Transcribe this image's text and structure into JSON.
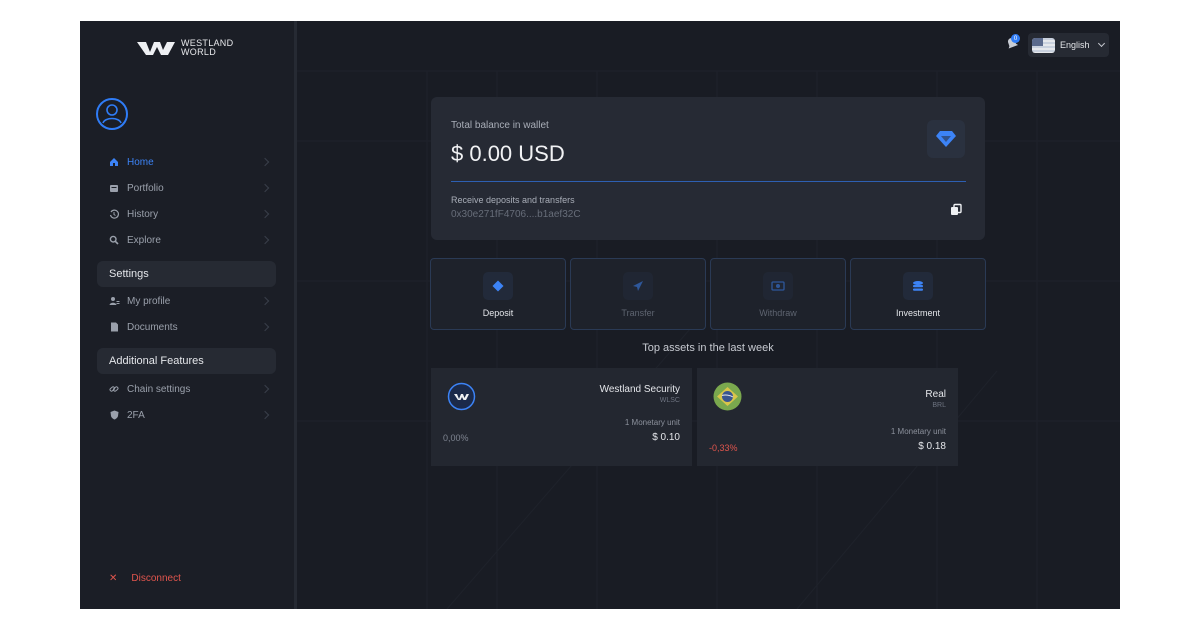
{
  "brand": {
    "line1": "WESTLAND",
    "line2": "WORLD"
  },
  "nav": {
    "main": [
      {
        "label": "Home",
        "icon": "home-icon",
        "active": true
      },
      {
        "label": "Portfolio",
        "icon": "portfolio-icon"
      },
      {
        "label": "History",
        "icon": "history-icon"
      },
      {
        "label": "Explore",
        "icon": "explore-icon"
      }
    ],
    "settings_heading": "Settings",
    "settings": [
      {
        "label": "My profile",
        "icon": "profile-icon"
      },
      {
        "label": "Documents",
        "icon": "document-icon"
      }
    ],
    "features_heading": "Additional Features",
    "features": [
      {
        "label": "Chain settings",
        "icon": "link-icon"
      },
      {
        "label": "2FA",
        "icon": "shield-icon"
      }
    ],
    "disconnect_label": "Disconnect"
  },
  "header": {
    "notification_count": "0",
    "language": "English"
  },
  "wallet": {
    "balance_label": "Total balance in wallet",
    "balance_value": "$ 0.00 USD",
    "receive_label": "Receive deposits and transfers",
    "address": "0x30e271fF4706....b1aef32C"
  },
  "actions": [
    {
      "label": "Deposit",
      "icon": "diamond-icon"
    },
    {
      "label": "Transfer",
      "icon": "send-icon"
    },
    {
      "label": "Withdraw",
      "icon": "bank-icon"
    },
    {
      "label": "Investment",
      "icon": "coins-icon"
    }
  ],
  "top_assets": {
    "title": "Top assets in the last week",
    "items": [
      {
        "name": "Westland Security",
        "code": "WLSC",
        "unit_label": "1 Monetary unit",
        "price": "$ 0.10",
        "change": "0,00%",
        "change_color": "#7e8490"
      },
      {
        "name": "Real",
        "code": "BRL",
        "unit_label": "1 Monetary unit",
        "price": "$ 0.18",
        "change": "-0,33%",
        "change_color": "#e0554d"
      }
    ]
  },
  "colors": {
    "accent": "#2f7cf6",
    "negative": "#e0554d",
    "background": "#191c24"
  }
}
